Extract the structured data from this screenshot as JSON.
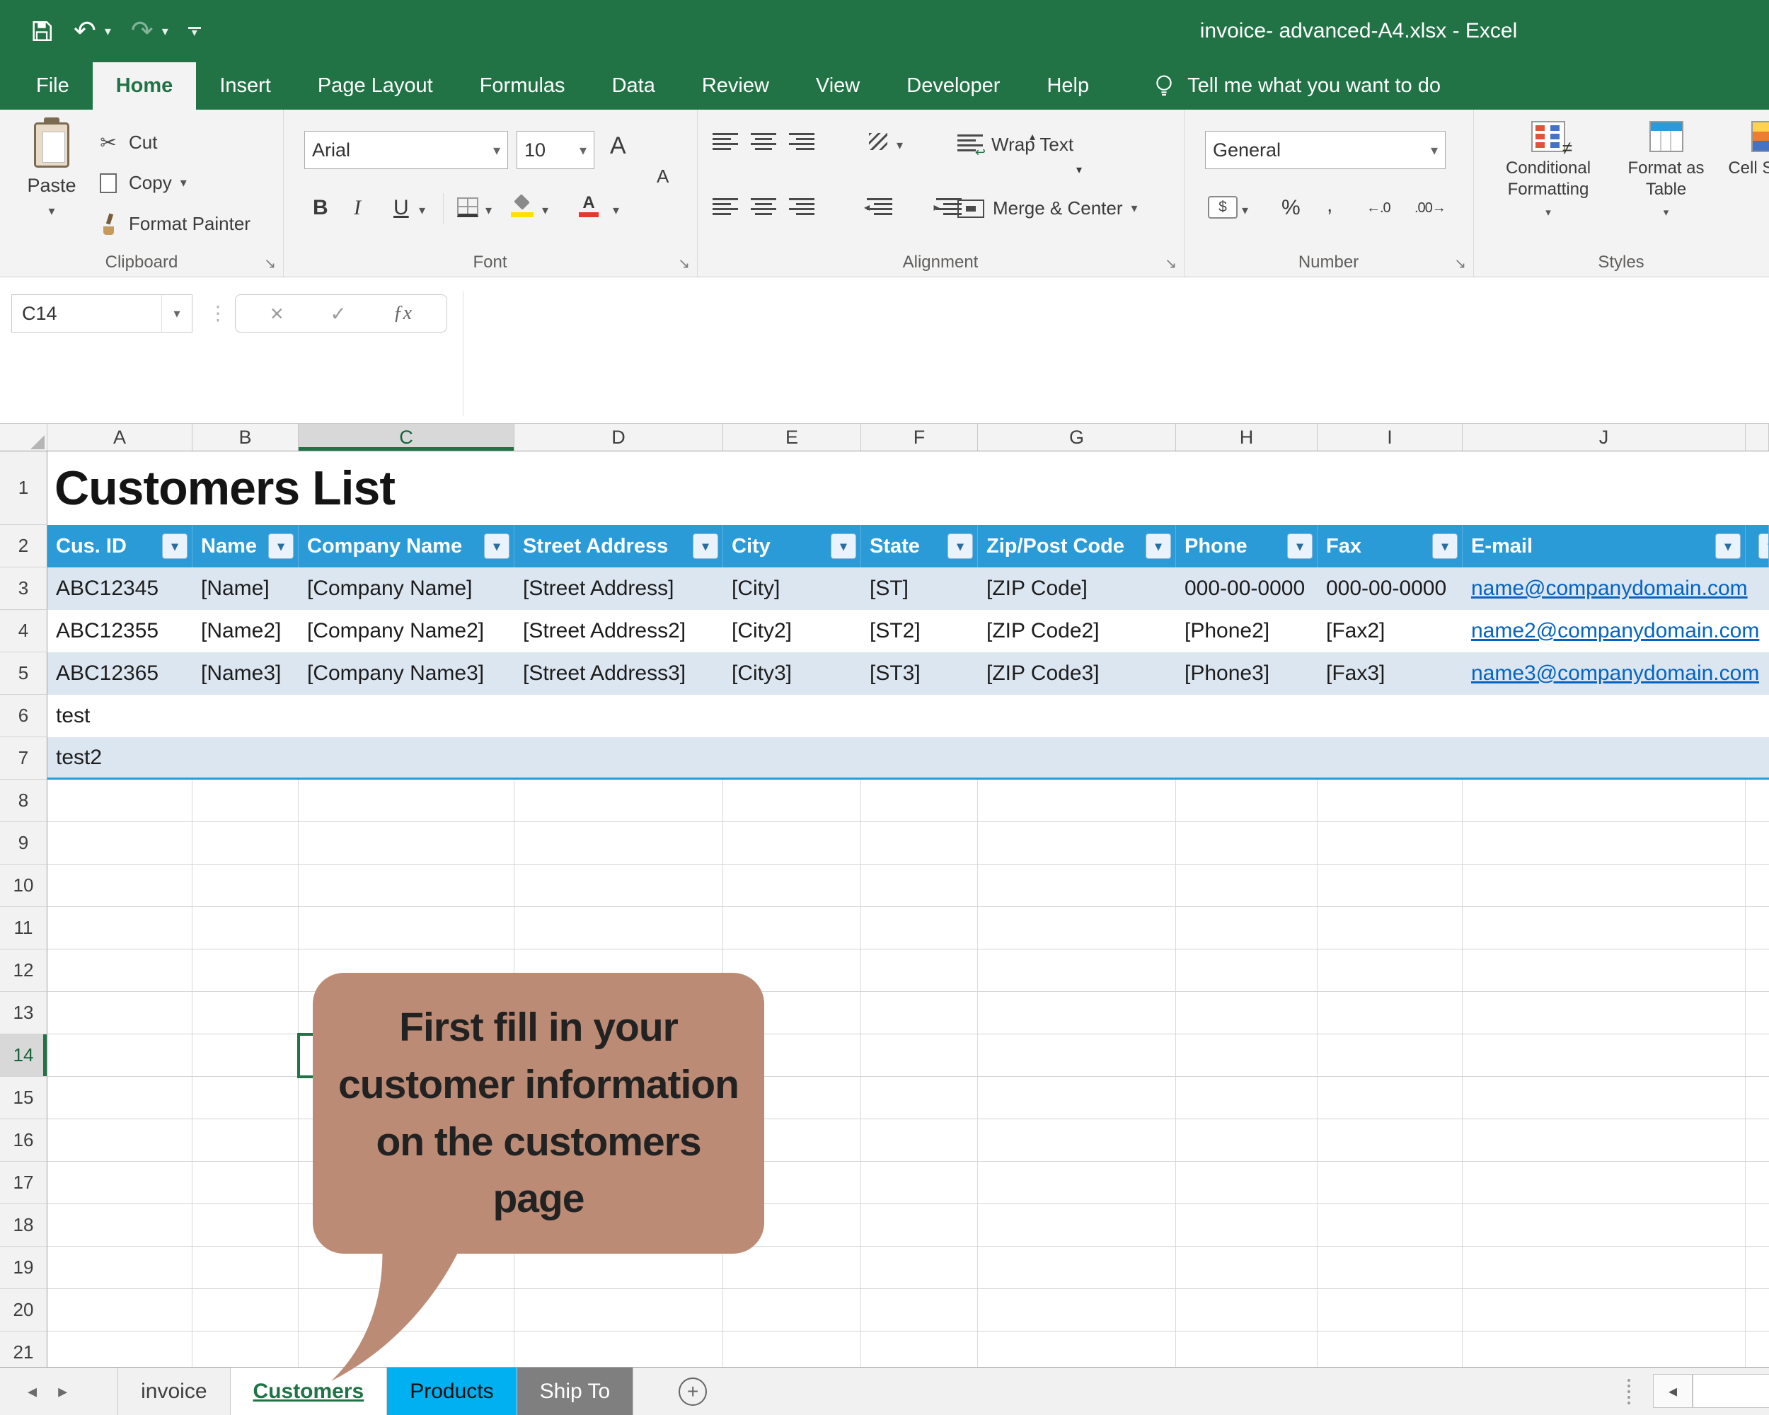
{
  "titlebar": {
    "title": "invoice- advanced-A4.xlsx - Excel"
  },
  "menu": {
    "tabs": [
      "File",
      "Home",
      "Insert",
      "Page Layout",
      "Formulas",
      "Data",
      "Review",
      "View",
      "Developer",
      "Help"
    ],
    "tell_me": "Tell me what you want to do"
  },
  "ribbon": {
    "clipboard": {
      "label": "Clipboard",
      "paste": "Paste",
      "cut": "Cut",
      "copy": "Copy",
      "format_painter": "Format Painter"
    },
    "font": {
      "label": "Font",
      "family": "Arial",
      "size": "10",
      "bold": "B",
      "italic": "I",
      "underline": "U",
      "grow": "A",
      "shrink": "A",
      "color_letter": "A"
    },
    "alignment": {
      "label": "Alignment",
      "wrap_text": "Wrap Text",
      "merge_center": "Merge & Center"
    },
    "number": {
      "label": "Number",
      "format": "General",
      "percent": "%",
      "comma": ",",
      "currency": "$"
    },
    "styles": {
      "label": "Styles",
      "conditional": "Conditional Formatting",
      "format_table": "Format as Table",
      "cell_styles": "Cell Styles"
    }
  },
  "formula_bar": {
    "name_box": "C14",
    "fx": "ƒx",
    "value": ""
  },
  "grid": {
    "columns": [
      "A",
      "B",
      "C",
      "D",
      "E",
      "F",
      "G",
      "H",
      "I",
      "J"
    ],
    "row_numbers": [
      "1",
      "2",
      "3",
      "4",
      "5",
      "6",
      "7",
      "8",
      "9",
      "10",
      "11",
      "12",
      "13",
      "14",
      "15",
      "16",
      "17",
      "18",
      "19",
      "20",
      "21"
    ],
    "selected_cell": "C14",
    "selected_column": "C",
    "selected_row": "14"
  },
  "sheet": {
    "title": "Customers List",
    "headers": [
      "Cus. ID",
      "Name",
      "Company Name",
      "Street Address",
      "City",
      "State",
      "Zip/Post Code",
      "Phone",
      "Fax",
      "E-mail"
    ],
    "rows": [
      [
        "ABC12345",
        "[Name]",
        "[Company Name]",
        "[Street Address]",
        "[City]",
        "[ST]",
        "[ZIP Code]",
        "000-00-0000",
        "000-00-0000",
        "name@companydomain.com"
      ],
      [
        "ABC12355",
        "[Name2]",
        "[Company Name2]",
        "[Street Address2]",
        "[City2]",
        "[ST2]",
        "[ZIP Code2]",
        "[Phone2]",
        "[Fax2]",
        "name2@companydomain.com"
      ],
      [
        "ABC12365",
        "[Name3]",
        "[Company Name3]",
        "[Street Address3]",
        "[City3]",
        "[ST3]",
        "[ZIP Code3]",
        "[Phone3]",
        "[Fax3]",
        "name3@companydomain.com"
      ]
    ],
    "row6": "test",
    "row7": "test2"
  },
  "callout": {
    "text": "First fill in your\ncustomer information\non the customers\npage"
  },
  "sheet_tabs": {
    "invoice": "invoice",
    "customers": "Customers",
    "products": "Products",
    "ship_to": "Ship To"
  },
  "colors": {
    "excel_green": "#217346",
    "header_blue": "#2B9BD7",
    "band_blue": "#DCE6F1",
    "link_blue": "#0563C1",
    "products_tab": "#00B0F0",
    "ship_to_tab": "#7F7F7F",
    "callout": "#BC8B75"
  }
}
